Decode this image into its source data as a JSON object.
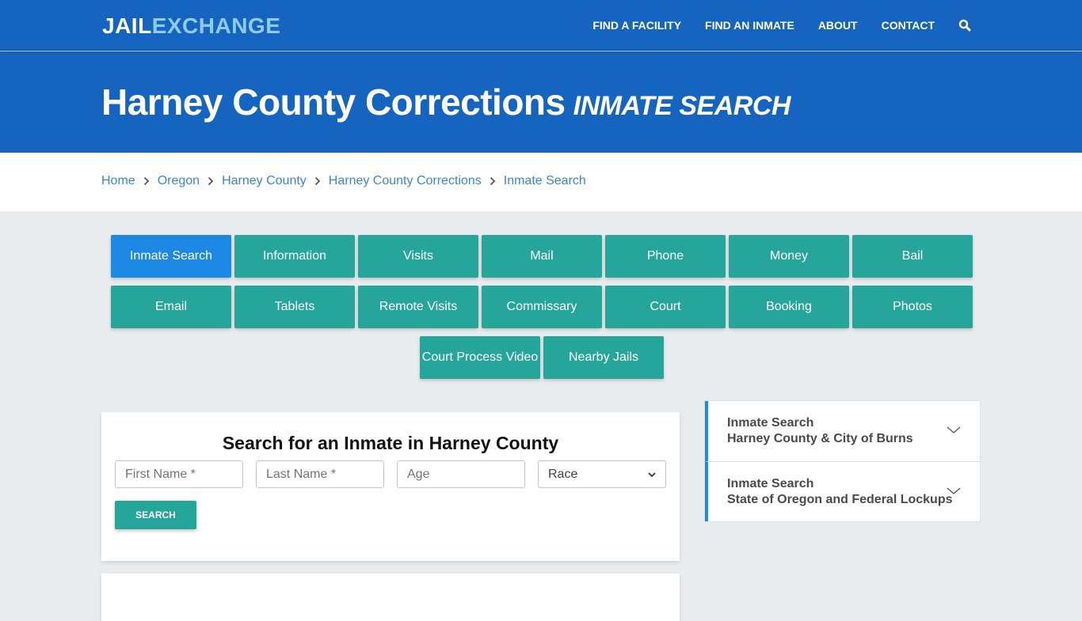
{
  "brand": {
    "logo_part1": "JAIL",
    "logo_part2": "EXCHANGE",
    "colors": {
      "primary": "#1565c0",
      "logo_accent": "#90caf9",
      "teal": "#26a69a",
      "active_tab": "#1e88e5",
      "link": "#3a86d4",
      "page_bg": "#e9ecef"
    }
  },
  "nav": {
    "links": [
      {
        "label": "FIND A FACILITY"
      },
      {
        "label": "FIND AN INMATE"
      },
      {
        "label": "ABOUT"
      },
      {
        "label": "CONTACT"
      }
    ],
    "search_icon": "search-icon"
  },
  "hero": {
    "title": "Harney County Corrections",
    "subtitle": "INMATE SEARCH"
  },
  "breadcrumb": [
    {
      "label": "Home"
    },
    {
      "label": "Oregon"
    },
    {
      "label": "Harney County"
    },
    {
      "label": "Harney County Corrections"
    },
    {
      "label": "Inmate Search"
    }
  ],
  "tabs": {
    "row1": [
      {
        "label": "Inmate Search",
        "active": true
      },
      {
        "label": "Information"
      },
      {
        "label": "Visits"
      },
      {
        "label": "Mail"
      },
      {
        "label": "Phone"
      },
      {
        "label": "Money"
      },
      {
        "label": "Bail"
      }
    ],
    "row2": [
      {
        "label": "Email"
      },
      {
        "label": "Tablets"
      },
      {
        "label": "Remote Visits"
      },
      {
        "label": "Commissary"
      },
      {
        "label": "Court"
      },
      {
        "label": "Booking"
      },
      {
        "label": "Photos"
      }
    ],
    "row3": [
      {
        "label": "Court Process Video"
      },
      {
        "label": "Nearby Jails"
      }
    ]
  },
  "search_form": {
    "title": "Search for an Inmate in Harney County",
    "first_name_placeholder": "First Name *",
    "last_name_placeholder": "Last Name *",
    "age_placeholder": "Age",
    "race_selected": "Race",
    "button_label": "SEARCH"
  },
  "sidebar": {
    "items": [
      {
        "line1": "Inmate Search",
        "line2": "Harney County & City of Burns"
      },
      {
        "line1": "Inmate Search",
        "line2": "State of Oregon and Federal Lockups"
      }
    ]
  }
}
